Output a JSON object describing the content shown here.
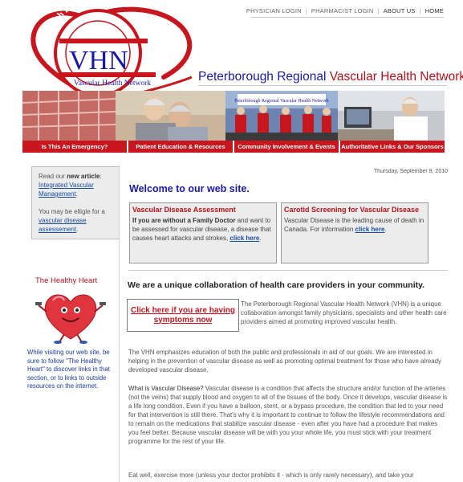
{
  "topnav": {
    "physician": "PHYSICIAN LOGIN",
    "pharmacist": "PHARMACIST LOGIN",
    "about": "ABOUT US",
    "home": "HOME"
  },
  "logo": {
    "arc_text": "Peterborough Regional",
    "big": "VHN",
    "sub": "Vascular Health Network"
  },
  "tagline": {
    "blue": "Peterborough Regional ",
    "red": "Vascular Health Network"
  },
  "menu": [
    "Is This An Emergency?",
    "Patient Education & Resources",
    "Community Involvement & Events",
    "Authoritative Links & Our Sponsors"
  ],
  "sidebar": {
    "read": "Read our ",
    "new_article": "new article",
    "colon": ":",
    "article_link": "Integrated Vascular Management",
    "dot": ".",
    "eligible": "You may be elligle for a ",
    "assessment_link": "vascular disease assessement",
    "healthy_heart_title": "The Healthy Heart",
    "healthy_heart_text": "While visiting our web site, be sure to follow \"The Healthy Heart\" to discover links in that section, or to links to outside resources on the internet."
  },
  "main": {
    "date": "Thursday, September 9, 2010",
    "welcome": "Welcome to our web site.",
    "box1": {
      "title": "Vascular Disease Assessment",
      "bold": "If you are without a Family Doctor",
      "text": " and want to be assessed for vascular disease, a disease that causes heart attacks and strokes, ",
      "link": "click here",
      "end": "."
    },
    "box2": {
      "title": "Carotid Screening for Vascular Disease",
      "text": "Vascular Disease is the leading cause of death in Canada. For information ",
      "link": "click here",
      "end": "."
    },
    "unique": "We are a unique collaboration of health care providers in your community.",
    "symptoms_button": "Click here if you are having symptoms now",
    "p1": "The Peterborough Regional Vascular Health Network (VHN) is a unique collaboration amongst family physicians, specialists and other health care providers aimed at promoting improved vascular health.",
    "p2": "The VHN emphasizes education of both the public and professionals in aid of our goals. We are interested in helping in the prevention of vascular disease as well as promoting optimal treatment for those who have already developed vascular disease.",
    "p3_lead": "What is Vascular Disease?",
    "p3": " Vascular disease is a condition that affects the structure and/or function of the arteries (not the veins) that supply blood and oxygen to all of the tissues of the body. Once it develops, vascular disease is a life long condition. Even if you have a balloon, stent, or a bypass procedure, the condition that led to your need for that intervention is still there. That's why it is important to continue to follow the lifestyle recommendations and to remain on the medications that stabilize vascular disease - even after you have had a procedure that makes you feel better. Because vascular disease will be with you your whole life, you must stick with your treatment programme for the rest of your life.",
    "p4": "Eat well, exercise more (unless your doctor prohibits it - which is only rarely necessary), and take your"
  },
  "colors": {
    "brand_red": "#c8161f",
    "brand_blue": "#1a1aa6"
  }
}
